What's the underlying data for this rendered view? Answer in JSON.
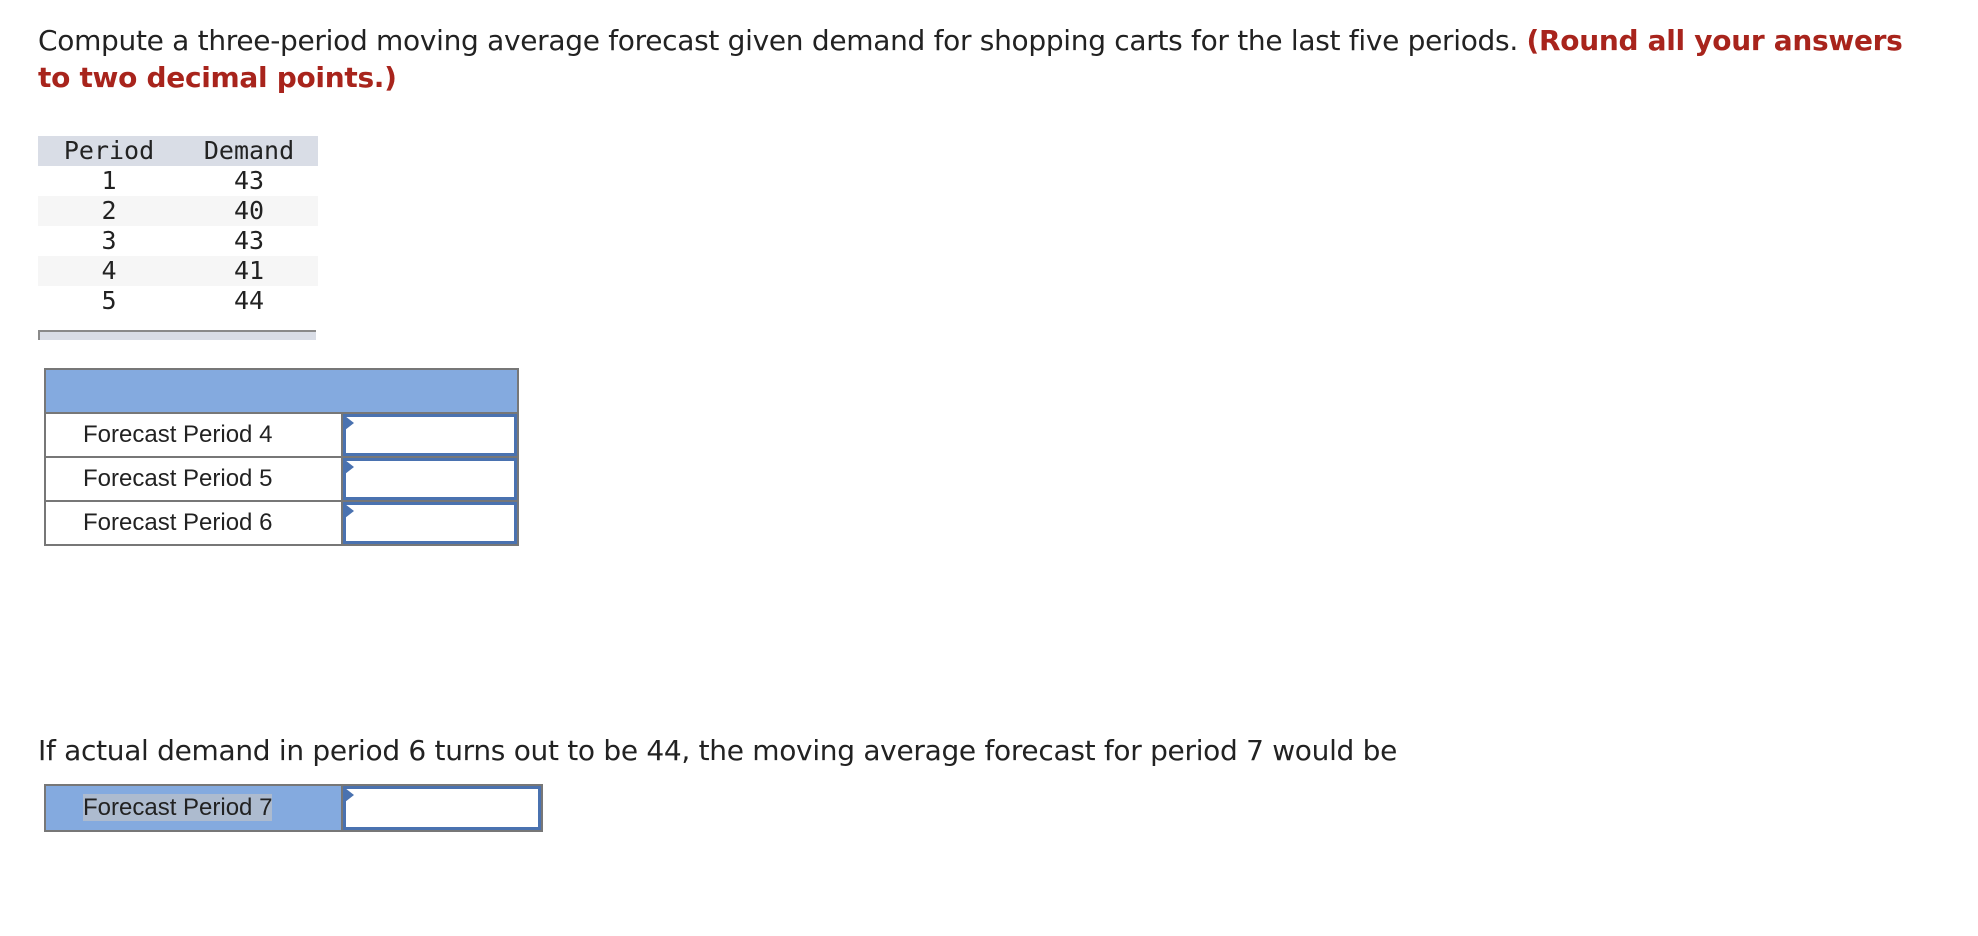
{
  "question": {
    "text": "Compute a three-period moving average forecast given demand for shopping carts for the last five periods. ",
    "hint": "(Round all your answers to two decimal points.)"
  },
  "given_table": {
    "headers": [
      "Period",
      "Demand"
    ],
    "rows": [
      {
        "period": "1",
        "demand": "43"
      },
      {
        "period": "2",
        "demand": "40"
      },
      {
        "period": "3",
        "demand": "43"
      },
      {
        "period": "4",
        "demand": "41"
      },
      {
        "period": "5",
        "demand": "44"
      }
    ]
  },
  "answer_table": {
    "header": "",
    "rows": [
      {
        "label": "Forecast Period 4",
        "value": ""
      },
      {
        "label": "Forecast Period 5",
        "value": ""
      },
      {
        "label": "Forecast Period 6",
        "value": ""
      }
    ]
  },
  "followup": {
    "text": "If actual demand in period 6 turns out to be 44, the moving average forecast for period 7 would be",
    "row": {
      "label": "Forecast Period 7",
      "value": ""
    }
  },
  "colors": {
    "hint_red": "#a8241c",
    "header_blue": "#84aadf",
    "input_border_blue": "#4a72b0",
    "table_header_gray": "#d9dde6"
  }
}
